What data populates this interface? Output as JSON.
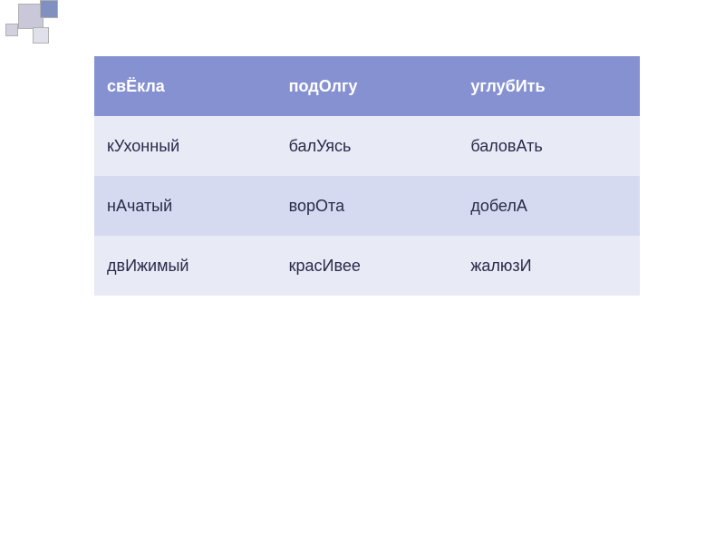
{
  "table": {
    "rows": [
      {
        "cells": [
          "свЁкла",
          "подОлгу",
          "углубИть"
        ],
        "type": "header"
      },
      {
        "cells": [
          "кУхонный",
          "балУясь",
          "баловАть"
        ],
        "type": "light"
      },
      {
        "cells": [
          "нАчатый",
          "ворОта",
          "добелА"
        ],
        "type": "mid"
      },
      {
        "cells": [
          "двИжимый",
          "красИвее",
          "жалюзИ"
        ],
        "type": "light"
      }
    ]
  }
}
